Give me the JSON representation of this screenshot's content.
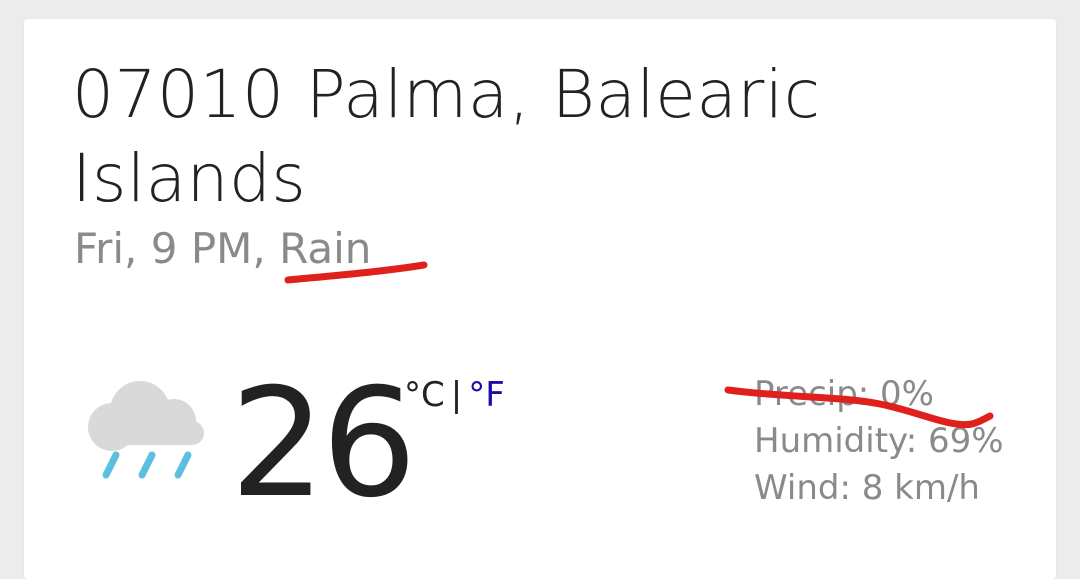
{
  "location": {
    "line1": "07010 Palma, Balearic",
    "line2": "Islands"
  },
  "conditions": {
    "day_time": "Fri, 9 PM, ",
    "description": "Rain"
  },
  "current": {
    "temperature": "26",
    "unit_c": "°C",
    "unit_separator": "|",
    "unit_f": "°F",
    "icon": "rain-cloud-icon"
  },
  "details": {
    "precip": "Precip: 0%",
    "humidity": "Humidity: 69%",
    "wind": "Wind: 8 km/h"
  },
  "colors": {
    "annotation_red": "#e0201c",
    "link_blue": "#1a0dab",
    "cloud_gray": "#d9d9d9",
    "rain_blue": "#5bc0de"
  }
}
